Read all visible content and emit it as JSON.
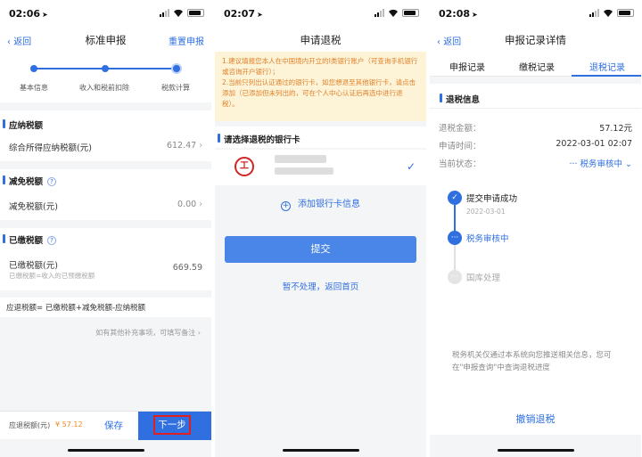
{
  "accent_color": "#2f6fe0",
  "phones": [
    {
      "time": "02:06",
      "nav": {
        "back": "返回",
        "title": "标准申报",
        "right": "重置申报"
      },
      "steps": [
        "基本信息",
        "收入和税前扣除",
        "税款计算"
      ],
      "sections": {
        "payable": {
          "title": "应纳税额",
          "label": "综合所得应纳税额(元)",
          "value": "612.47"
        },
        "relief": {
          "title": "减免税额",
          "label": "减免税额(元)",
          "value": "0.00"
        },
        "paid": {
          "title": "已缴税额",
          "label": "已缴税额(元)",
          "sub": "已缴税额=收入的已预缴税额",
          "value": "669.59"
        }
      },
      "formula": "应退税额= 已缴税额+减免税额-应纳税额",
      "remark": "如有其他补充事项，可填写备注",
      "bottom": {
        "refund_label": "应退税额(元)",
        "refund_value": "¥ 57.12",
        "save": "保存",
        "next": "下一步"
      }
    },
    {
      "time": "02:07",
      "nav": {
        "title": "申请退税"
      },
      "notice": "1.建议填报您本人在中国境内开立的Ⅰ类银行账户（可查询手机银行或咨询开户银行）；\n2.当前只列出认证通过的银行卡，如您想退至其他银行卡，请点击添加（已添加但未列出的，可在个人中心认证后再选中进行退税）。",
      "select_title": "请选择退税的银行卡",
      "add_card": "添加银行卡信息",
      "submit": "提交",
      "skip": "暂不处理，返回首页"
    },
    {
      "time": "02:08",
      "nav": {
        "back": "返回",
        "title": "申报记录详情"
      },
      "tabs": [
        "申报记录",
        "缴税记录",
        "退税记录"
      ],
      "section_title": "退税信息",
      "fields": [
        {
          "label": "退税金额：",
          "value": "57.12元"
        },
        {
          "label": "申请时间：",
          "value": "2022-03-01 02:07"
        },
        {
          "label": "当前状态：",
          "value": "··· 税务审核中 ⌄"
        }
      ],
      "timeline": [
        {
          "label": "提交申请成功",
          "date": "2022-03-01"
        },
        {
          "label": "税务审核中"
        },
        {
          "label": "国库处理"
        }
      ],
      "note": "税务机关仅通过本系统向您推送相关信息，您可在\"申报查询\"中查询退税进度",
      "cancel": "撤销退税"
    }
  ]
}
